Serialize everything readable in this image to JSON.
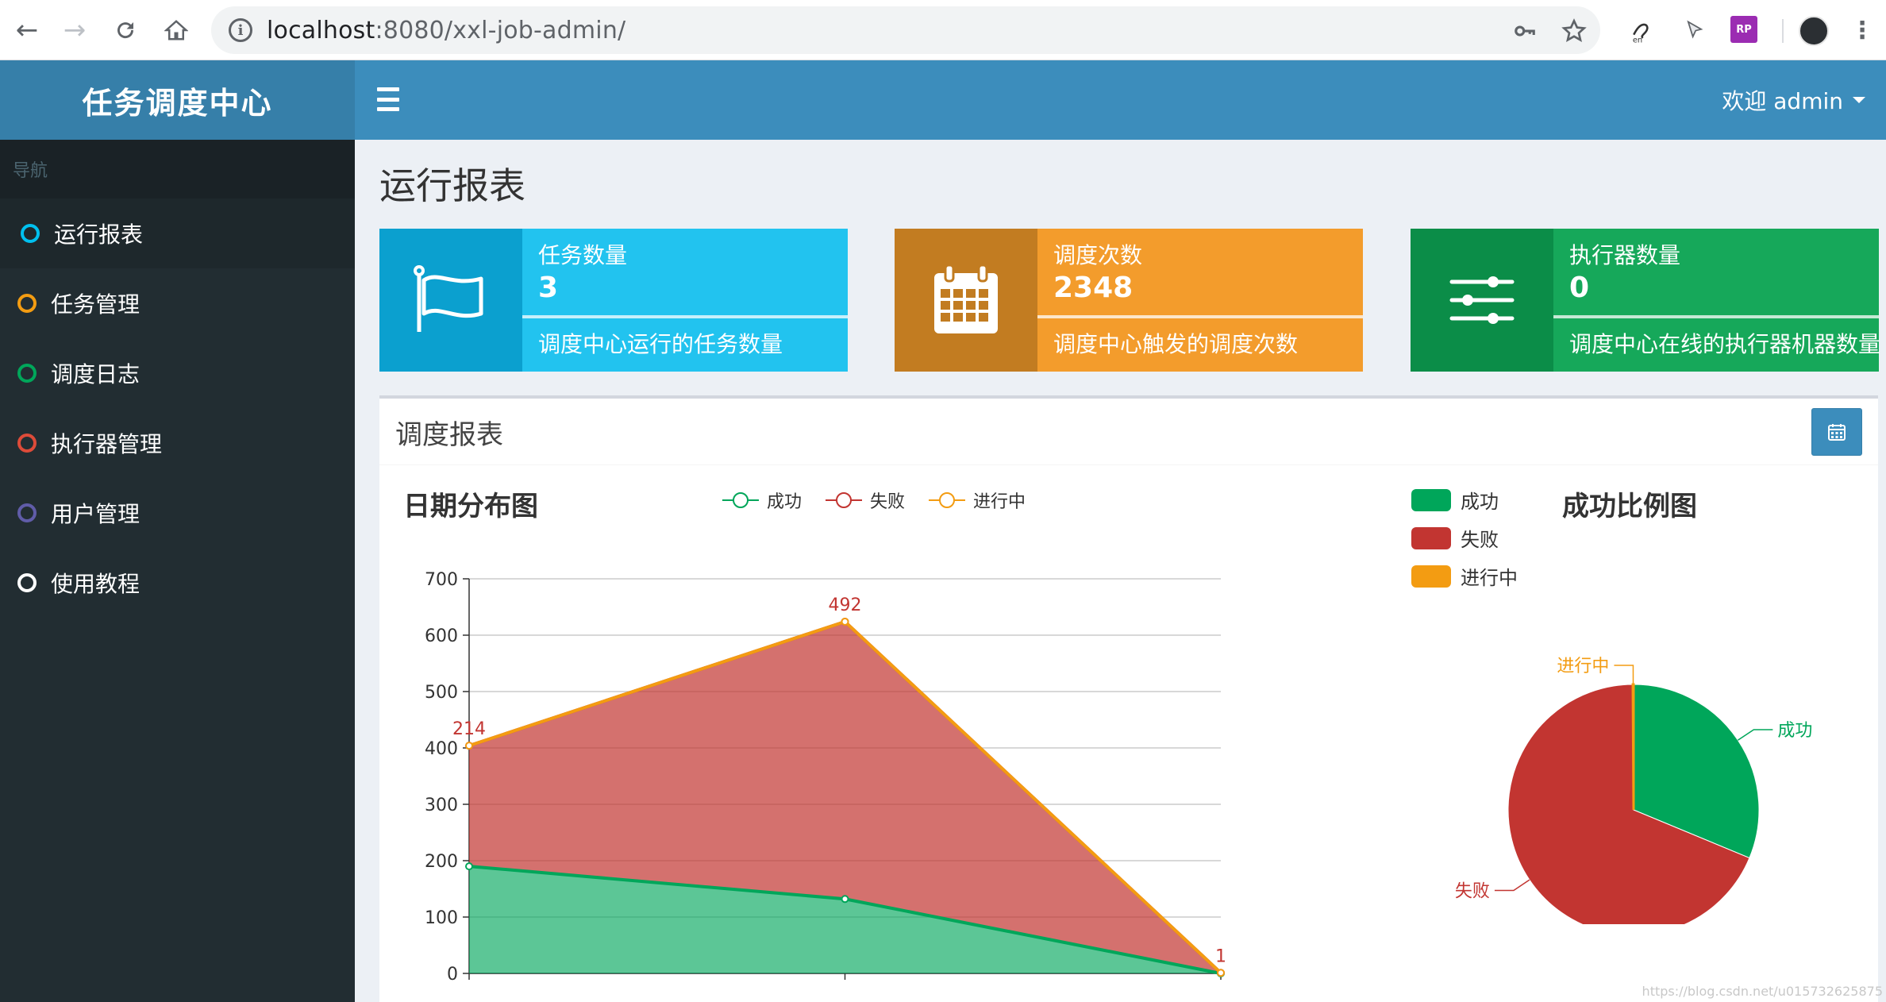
{
  "browser": {
    "url_host": "localhost",
    "url_path": ":8080/xxl-job-admin/",
    "info_glyph": "i"
  },
  "sidebar": {
    "logo": "任务调度中心",
    "nav_header": "导航",
    "items": [
      {
        "label": "运行报表",
        "color": "#00c0ef",
        "active": true
      },
      {
        "label": "任务管理",
        "color": "#f39c12",
        "active": false
      },
      {
        "label": "调度日志",
        "color": "#00a65a",
        "active": false
      },
      {
        "label": "执行器管理",
        "color": "#dd4b39",
        "active": false
      },
      {
        "label": "用户管理",
        "color": "#605ca8",
        "active": false
      },
      {
        "label": "使用教程",
        "color": "#ffffff",
        "active": false
      }
    ]
  },
  "header": {
    "welcome": "欢迎 admin"
  },
  "page": {
    "title": "运行报表"
  },
  "info_boxes": [
    {
      "title": "任务数量",
      "value": "3",
      "desc": "调度中心运行的任务数量",
      "icon": "flag-icon",
      "color": "#00c0ef"
    },
    {
      "title": "调度次数",
      "value": "2348",
      "desc": "调度中心触发的调度次数",
      "icon": "calendar-icon",
      "color": "#f39c12"
    },
    {
      "title": "执行器数量",
      "value": "0",
      "desc": "调度中心在线的执行器机器数量",
      "icon": "sliders-icon",
      "color": "#00a65a"
    }
  ],
  "report": {
    "title": "调度报表",
    "line_chart_title": "日期分布图",
    "pie_chart_title": "成功比例图"
  },
  "chart_data": [
    {
      "type": "area",
      "title": "日期分布图",
      "stacked": true,
      "ylim": [
        0,
        700
      ],
      "yticks": [
        0,
        100,
        200,
        300,
        400,
        500,
        600,
        700
      ],
      "x_count": 3,
      "series": [
        {
          "name": "成功",
          "values": [
            190,
            132,
            0
          ],
          "color": "#00a65a"
        },
        {
          "name": "失败",
          "values": [
            214,
            492,
            1
          ],
          "color": "#c23531"
        },
        {
          "name": "进行中",
          "values": [
            0,
            0,
            0
          ],
          "color": "#f39c12"
        }
      ],
      "top_labels": [
        "214",
        "492",
        "1"
      ],
      "legend_position": "top"
    },
    {
      "type": "pie",
      "title": "成功比例图",
      "slices": [
        {
          "name": "成功",
          "value": 322,
          "color": "#00a65a"
        },
        {
          "name": "失败",
          "value": 707,
          "color": "#c23531"
        },
        {
          "name": "进行中",
          "value": 1,
          "color": "#f39c12"
        }
      ],
      "legend_position": "top-left"
    }
  ],
  "watermark": "https://blog.csdn.net/u015732625875"
}
